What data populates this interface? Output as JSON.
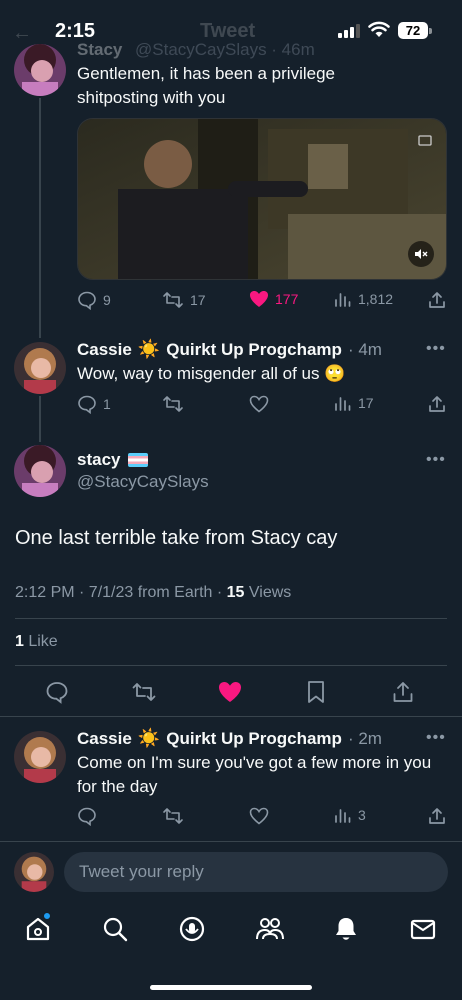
{
  "status_bar": {
    "time": "2:15",
    "battery": "72",
    "header_title": "Tweet"
  },
  "prev_tweet": {
    "author_name": "Stacy",
    "handle_time": "@StacyCaySlays · 46m",
    "text": "Gentlemen, it has been a privilege shitposting with you",
    "media_icon": "speaker-muted-icon",
    "actions": {
      "replies": "9",
      "retweets": "17",
      "likes": "177",
      "views": "1,812"
    }
  },
  "reply_1": {
    "author_name": "Cassie",
    "author_badge": "Quirkt Up Progchamp",
    "time": "· 4m",
    "text": "Wow, way to misgender all of us 🙄",
    "actions": {
      "replies": "1",
      "retweets": "",
      "likes": "",
      "views": "17"
    }
  },
  "main_tweet": {
    "author_name": "stacy",
    "handle": "@StacyCaySlays",
    "text": "One last terrible take from Stacy cay",
    "timestamp": "2:12 PM · 7/1/23 from Earth · ",
    "views_count": "15",
    "views_label": " Views",
    "likes_count": "1",
    "likes_label": " Like"
  },
  "reply_2": {
    "author_name": "Cassie",
    "author_badge": "Quirkt Up Progchamp",
    "time": "· 2m",
    "text": "Come on I'm sure you've got a few more in you for the day",
    "actions": {
      "replies": "",
      "retweets": "",
      "likes": "",
      "views": "3"
    }
  },
  "reply_box": {
    "placeholder": "Tweet your reply"
  },
  "colors": {
    "background": "#15202b",
    "accent": "#1d9bf0",
    "like": "#f91880",
    "muted": "#8b98a5"
  },
  "bottom_nav": [
    "home-icon",
    "search-icon",
    "spaces-icon",
    "communities-icon",
    "notifications-icon",
    "messages-icon"
  ]
}
